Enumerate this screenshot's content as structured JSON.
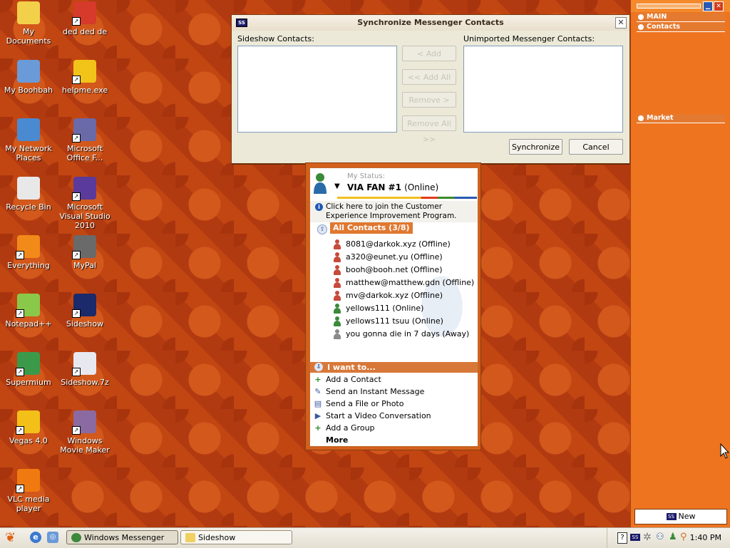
{
  "desktop": {
    "icons": [
      {
        "label": "My Documents",
        "icon": "folder-documents-icon",
        "color": "#f3d04a"
      },
      {
        "label": "ded ded de",
        "icon": "angry-bird-icon",
        "color": "#d63a2a"
      },
      {
        "label": "My Boohbah",
        "icon": "computer-icon",
        "color": "#6a9ad8"
      },
      {
        "label": "helpme.exe",
        "icon": "yellow-bird-icon",
        "color": "#f2c41a"
      },
      {
        "label": "My Network Places",
        "icon": "network-icon",
        "color": "#4a8ad0"
      },
      {
        "label": "Microsoft Office F...",
        "icon": "office-icon",
        "color": "#6a6aa8"
      },
      {
        "label": "Recycle Bin",
        "icon": "recycle-bin-icon",
        "color": "#e8e8e8"
      },
      {
        "label": "Microsoft Visual Studio 2010",
        "icon": "visual-studio-icon",
        "color": "#5a3a9a"
      },
      {
        "label": "Everything",
        "icon": "everything-search-icon",
        "color": "#f28a1a"
      },
      {
        "label": "MyPal",
        "icon": "raccoon-icon",
        "color": "#6a6a6a"
      },
      {
        "label": "Notepad++",
        "icon": "notepad-icon",
        "color": "#8ac84a"
      },
      {
        "label": "Sideshow",
        "icon": "sideshow-icon",
        "color": "#1a2a6a"
      },
      {
        "label": "Supermium",
        "icon": "browser-icon",
        "color": "#3a9a4a"
      },
      {
        "label": "Sideshow.7z",
        "icon": "archive-icon",
        "color": "#e8e8f0"
      },
      {
        "label": "Vegas 4.0",
        "icon": "vegas-icon",
        "color": "#f2c018"
      },
      {
        "label": "Windows Movie Maker",
        "icon": "movie-maker-icon",
        "color": "#8a6aa0"
      },
      {
        "label": "VLC media player",
        "icon": "vlc-cone-icon",
        "color": "#f07a10"
      }
    ]
  },
  "sync_dialog": {
    "title": "Synchronize Messenger Contacts",
    "close": "✕",
    "sideshow_label": "Sideshow Contacts:",
    "unimported_label": "Unimported Messenger Contacts:",
    "add": "< Add",
    "add_all": "<< Add All",
    "remove": "Remove >",
    "remove_all": "Remove All >>",
    "synchronize": "Synchronize",
    "cancel": "Cancel"
  },
  "messenger": {
    "my_status_label": "My Status:",
    "name": "VIA FAN #1",
    "status": "(Online)",
    "info_text": "Click here to join the Customer Experience Improvement Program.",
    "group_label": "All Contacts (3/8)",
    "contacts": [
      {
        "name": "8081@darkok.xyz (Offline)",
        "state": "offline"
      },
      {
        "name": "a320@eunet.yu (Offline)",
        "state": "offline"
      },
      {
        "name": "booh@booh.net (Offline)",
        "state": "offline"
      },
      {
        "name": "matthew@matthew.gdn (Offline)",
        "state": "offline"
      },
      {
        "name": "mv@darkok.xyz (Offline)",
        "state": "offline"
      },
      {
        "name": "yellows111 (Online)",
        "state": "online"
      },
      {
        "name": "yellows111 tsuu (Online)",
        "state": "online"
      },
      {
        "name": "you gonna die in 7 days (Away)",
        "state": "away"
      }
    ],
    "i_want_to": "I want to...",
    "tasks": [
      {
        "label": "Add a Contact",
        "icon": "plus-icon"
      },
      {
        "label": "Send an Instant Message",
        "icon": "message-icon"
      },
      {
        "label": "Send a File or Photo",
        "icon": "file-photo-icon"
      },
      {
        "label": "Start a Video Conversation",
        "icon": "video-icon"
      },
      {
        "label": "Add a Group",
        "icon": "plus-icon"
      }
    ],
    "more": "More"
  },
  "sidebar": {
    "sections": [
      {
        "label": "MAIN"
      },
      {
        "label": "Contacts"
      },
      {
        "label": "Market"
      }
    ],
    "new_button": "New",
    "new_logo": "SS"
  },
  "taskbar": {
    "buttons": [
      {
        "label": "Windows Messenger",
        "icon": "messenger-icon",
        "active": true
      },
      {
        "label": "Sideshow",
        "icon": "folder-icon",
        "active": false
      }
    ],
    "clock": "1:40 PM"
  }
}
